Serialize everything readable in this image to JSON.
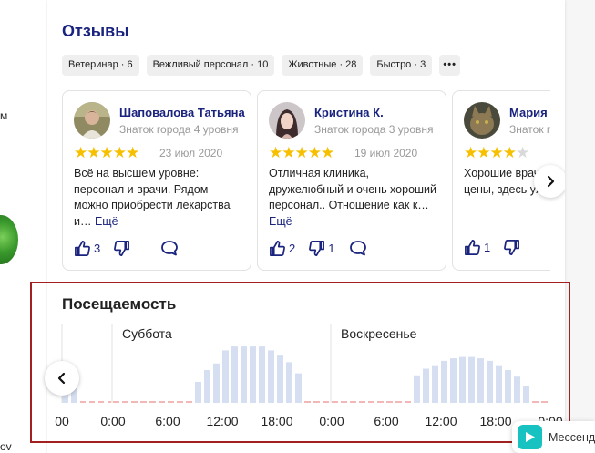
{
  "left": {
    "text_m": "м",
    "text_ov": "ov"
  },
  "reviews": {
    "title": "Отзывы",
    "tags": [
      "Ветеринар · 6",
      "Вежливый персонал · 10",
      "Животные · 28",
      "Быстро · 3"
    ],
    "tag_more": "•••",
    "items": [
      {
        "name": "Шаповалова Татьяна",
        "subtitle": "Знаток города 4 уровня",
        "rating": 5,
        "stars_on": "★★★★★",
        "stars_off": "",
        "date": "23 июл 2020",
        "text": "Всё на высшем уровне: персонал и врачи. Рядом можно приобрести лекарства и…",
        "more": "Ещё",
        "likes": "3",
        "dislikes": ""
      },
      {
        "name": "Кристина К.",
        "subtitle": "Знаток города 3 уровня",
        "rating": 5,
        "stars_on": "★★★★★",
        "stars_off": "",
        "date": "19 июл 2020",
        "text": "Отличная клиника, дружелюбный и очень хороший персонал.. Отношение как к…",
        "more": "Ещё",
        "likes": "2",
        "dislikes": "1"
      },
      {
        "name": "Мария",
        "subtitle": "Знаток города",
        "rating": 4,
        "stars_on": "★★★★",
        "stars_off": "★",
        "date": "",
        "text": "Хорошие врачи, адекватные цены, здесь уже неско",
        "more": "",
        "likes": "1",
        "dislikes": ""
      }
    ]
  },
  "attendance": {
    "title": "Посещаемость",
    "day_labels": [
      "Суббота",
      "Воскресенье"
    ],
    "time_labels": [
      "00",
      "0:00",
      "6:00",
      "12:00",
      "18:00",
      "0:00",
      "6:00",
      "12:00",
      "18:00",
      "0:00"
    ]
  },
  "chart_data": {
    "type": "bar",
    "title": "Посещаемость",
    "series": [
      {
        "name": "Суббота",
        "values": [
          0,
          0,
          0,
          0,
          0,
          0,
          0,
          0,
          0,
          0.32,
          0.5,
          0.6,
          0.8,
          0.86,
          0.86,
          0.86,
          0.86,
          0.8,
          0.72,
          0.62,
          0.45,
          0,
          0,
          0
        ]
      },
      {
        "name": "Воскресенье",
        "values": [
          0,
          0,
          0,
          0,
          0,
          0,
          0,
          0,
          0,
          0.42,
          0.52,
          0.56,
          0.64,
          0.68,
          0.7,
          0.7,
          0.68,
          0.64,
          0.56,
          0.5,
          0.4,
          0.25,
          0,
          0
        ]
      }
    ],
    "colors": {
      "bar": "#d6dff2",
      "empty": "#f2b8b8"
    }
  },
  "messenger": {
    "label": "Мессенджер"
  },
  "colors": {
    "accent": "#1a237e",
    "star": "#f6c000",
    "highlight": "#a32020"
  }
}
